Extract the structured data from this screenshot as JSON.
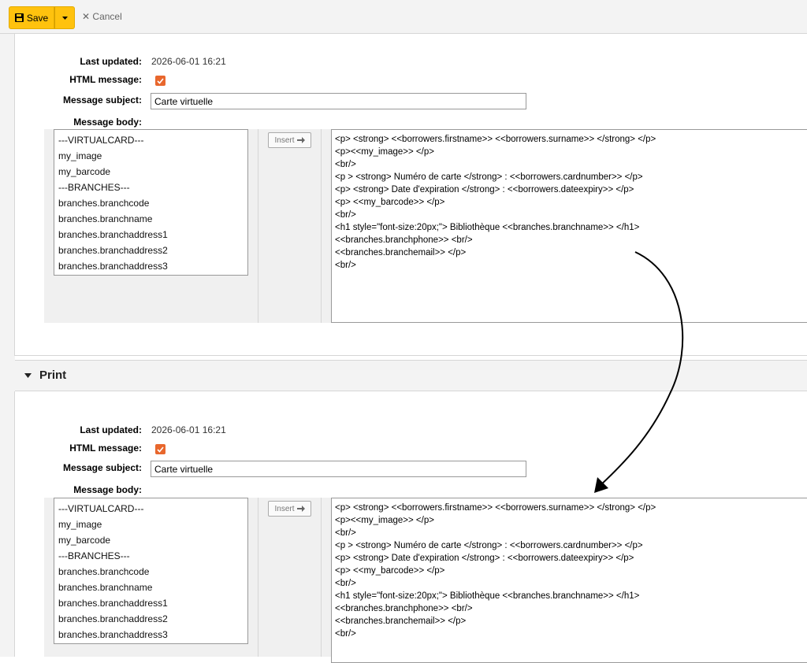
{
  "toolbar": {
    "save_label": "Save",
    "cancel_label": "Cancel"
  },
  "sections": [
    {
      "last_updated_label": "Last updated:",
      "last_updated": "2026-06-01 16:21",
      "html_message_label": "HTML message:",
      "html_message_checked": true,
      "subject_label": "Message subject:",
      "subject": "Carte virtuelle",
      "body_label": "Message body:",
      "insert_label": "Insert"
    },
    {
      "header": "Print",
      "last_updated_label": "Last updated:",
      "last_updated": "2026-06-01 16:21",
      "html_message_label": "HTML message:",
      "html_message_checked": true,
      "subject_label": "Message subject:",
      "subject": "Carte virtuelle",
      "body_label": "Message body:",
      "insert_label": "Insert"
    }
  ],
  "fields": [
    "---VIRTUALCARD---",
    "my_image",
    "my_barcode",
    "---BRANCHES---",
    "branches.branchcode",
    "branches.branchname",
    "branches.branchaddress1",
    "branches.branchaddress2",
    "branches.branchaddress3"
  ],
  "body_lines": [
    "<p>  <strong> <<borrowers.firstname>> <<borrowers.surname>> </strong> </p>",
    "<p><<my_image>> </p>",
    "<br/>",
    "<p > <strong> Numéro de carte </strong> : <<borrowers.cardnumber>>  </p>",
    "<p> <strong> Date d'expiration </strong> : <<borrowers.dateexpiry>> </p>",
    "<p> <<my_barcode>> </p>",
    "<br/>",
    "<h1 style=\"font-size:20px;\"> Bibliothèque <<branches.branchname>> </h1>",
    "<<branches.branchphone>> <br/>",
    "<<branches.branchemail>> </p>",
    "<br/>"
  ],
  "colors": {
    "save": "#ffc20e",
    "checkbox": "#e8672d",
    "arrow": "#000000"
  }
}
